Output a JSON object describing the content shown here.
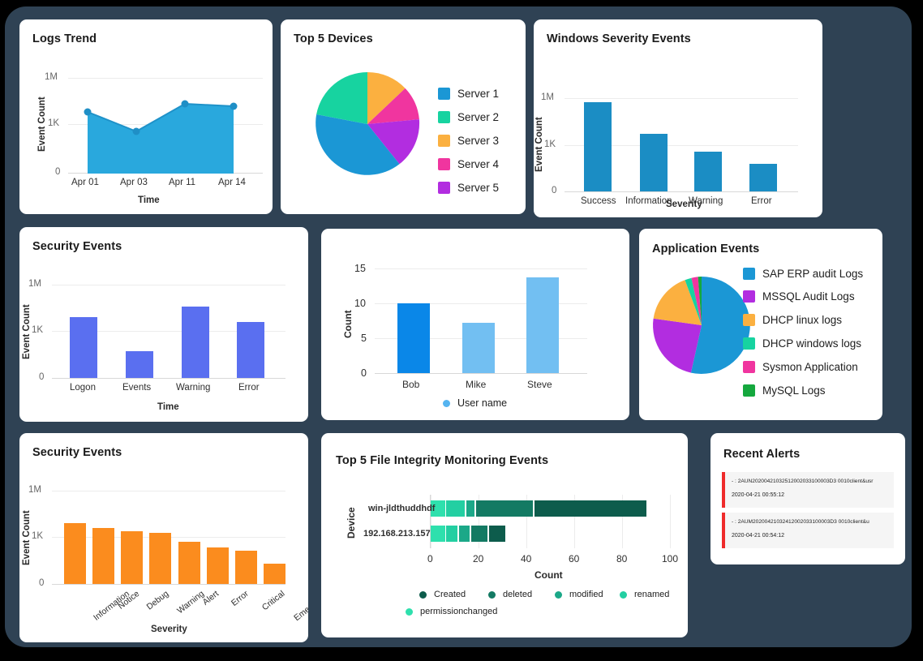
{
  "theme": {
    "panel_bg": "#2f4254",
    "card_bg": "#ffffff",
    "accent_blue": "#1f9fd4",
    "accent_indigo": "#5a6ff0",
    "accent_orange": "#fb8c1e",
    "accent_teal": "#0f7a66",
    "alert_red": "#ef2b2b"
  },
  "cards": {
    "logs_trend": {
      "title": "Logs Trend"
    },
    "top5_devices": {
      "title": "Top 5 Devices"
    },
    "windows_severity": {
      "title": "Windows Severity Events"
    },
    "security_events_time": {
      "title": "Security Events"
    },
    "user_counts": {
      "title": ""
    },
    "application_events": {
      "title": "Application Events"
    },
    "security_events_severity": {
      "title": "Security Events"
    },
    "fim_events": {
      "title": "Top 5 File Integrity Monitoring Events"
    },
    "recent_alerts": {
      "title": "Recent Alerts"
    }
  },
  "chart_data": [
    {
      "id": "logs_trend",
      "type": "area",
      "title": "Logs Trend",
      "xlabel": "Time",
      "ylabel": "Event Count",
      "categories": [
        "Apr 01",
        "Apr 03",
        "Apr 11",
        "Apr 14"
      ],
      "values": [
        1400,
        760,
        1950,
        1850
      ],
      "ytick_labels": [
        "0",
        "1K",
        "1M"
      ],
      "ytick_positions": [
        0,
        1000,
        1000000
      ],
      "ylim": [
        0,
        1000000
      ],
      "grid": true,
      "legend": "none",
      "color": "#29a8dd",
      "marker_color": "#1f8fc6"
    },
    {
      "id": "top5_devices",
      "type": "pie",
      "title": "Top 5 Devices",
      "labels": [
        "Server 1",
        "Server 2",
        "Server 3",
        "Server 4",
        "Server 5"
      ],
      "values": [
        40,
        20,
        13,
        13,
        14
      ],
      "colors": [
        "#1b97d5",
        "#17d3a0",
        "#fbb040",
        "#f0359f",
        "#b22de0"
      ],
      "legend": "right"
    },
    {
      "id": "windows_severity",
      "type": "bar",
      "title": "Windows Severity Events",
      "xlabel": "Severity",
      "ylabel": "Event Count",
      "categories": [
        "Success",
        "Information",
        "Warning",
        "Error"
      ],
      "values": [
        800000,
        1600,
        690,
        430
      ],
      "bar_fractions": [
        0.865,
        0.615,
        0.455,
        0.355
      ],
      "ytick_labels": [
        "0",
        "1K",
        "1M"
      ],
      "ylim": [
        0,
        1000000
      ],
      "grid": true,
      "color": "#1b8dc4"
    },
    {
      "id": "security_events_time",
      "type": "bar",
      "title": "Security Events",
      "xlabel": "Time",
      "ylabel": "Event Count",
      "categories": [
        "Logon",
        "Events",
        "Warning",
        "Error"
      ],
      "values": [
        2400,
        420,
        5800,
        1700
      ],
      "bar_fractions": [
        0.655,
        0.29,
        0.77,
        0.6
      ],
      "ytick_labels": [
        "0",
        "1K",
        "1M"
      ],
      "ylim": [
        0,
        1000000
      ],
      "grid": true,
      "color": "#5a6ff0"
    },
    {
      "id": "user_counts",
      "type": "bar",
      "title": "",
      "xlabel": "",
      "ylabel": "Count",
      "categories": [
        "Bob",
        "Mike",
        "Steve"
      ],
      "values": [
        10,
        7.2,
        13.7
      ],
      "ytick_labels": [
        "0",
        "5",
        "10",
        "15"
      ],
      "ylim": [
        0,
        15
      ],
      "grid": true,
      "legend_label": "User name",
      "legend": "bottom",
      "colors": [
        "#0a87e8",
        "#72bff2",
        "#72bff2"
      ]
    },
    {
      "id": "application_events",
      "type": "pie",
      "title": "Application Events",
      "labels": [
        "SAP ERP audit Logs",
        "MSSQL Audit Logs",
        "DHCP linux logs",
        "DHCP windows logs",
        "Sysmon Application",
        "MySQL Logs"
      ],
      "values": [
        53.5,
        22,
        18,
        2.2,
        2.3,
        2.0
      ],
      "colors": [
        "#1b97d5",
        "#b22de0",
        "#fbb040",
        "#17d3a0",
        "#f0359f",
        "#15a83e"
      ],
      "legend": "right"
    },
    {
      "id": "security_events_severity",
      "type": "bar",
      "title": "Security Events",
      "xlabel": "Severity",
      "ylabel": "Event Count",
      "categories": [
        "Information",
        "Notice",
        "Debug",
        "Warning",
        "Alert",
        "Error",
        "Critical",
        "Emergency"
      ],
      "values": [
        2400,
        1900,
        1500,
        1350,
        930,
        700,
        600,
        250
      ],
      "bar_fractions": [
        0.655,
        0.6,
        0.565,
        0.545,
        0.455,
        0.39,
        0.355,
        0.215
      ],
      "ytick_labels": [
        "0",
        "1K",
        "1M"
      ],
      "ylim": [
        0,
        1000000
      ],
      "grid": true,
      "color": "#fb8c1e"
    },
    {
      "id": "fim_events",
      "type": "bar",
      "orientation": "horizontal",
      "stacked": true,
      "title": "Top 5 File Integrity Monitoring Events",
      "xlabel": "Count",
      "ylabel": "Device",
      "categories": [
        "win-jldthuddhdf",
        "192.168.213.157"
      ],
      "series": [
        {
          "name": "permissionchanged",
          "color": "#2ee0ad",
          "values": [
            6,
            6
          ]
        },
        {
          "name": "renamed",
          "color": "#23cfa2",
          "values": [
            8,
            5
          ]
        },
        {
          "name": "modified",
          "color": "#1ba888",
          "values": [
            4,
            5
          ]
        },
        {
          "name": "deleted",
          "color": "#137a63",
          "values": [
            24,
            7
          ]
        },
        {
          "name": "Created",
          "color": "#0d5c4c",
          "values": [
            47,
            7
          ]
        }
      ],
      "xtick_labels": [
        "0",
        "20",
        "40",
        "60",
        "80",
        "100"
      ],
      "xlim": [
        0,
        100
      ],
      "legend": "bottom",
      "legend_order": [
        "Created",
        "deleted",
        "modified",
        "renamed",
        "permissionchanged"
      ],
      "legend_colors": [
        "#0d5c4c",
        "#137a63",
        "#1ba888",
        "#23cfa2",
        "#2ee0ad"
      ]
    }
  ],
  "recent_alerts": {
    "title": "Recent Alerts",
    "items": [
      {
        "message": "- : 2AUN20200421032512002033100003D3 0010client&usr",
        "timestamp": "2020-04-21 00:55:12"
      },
      {
        "message": " - : 2AUM20200421032412002033100003D3 0010client&u",
        "timestamp": "2020-04-21 00:54:12"
      }
    ]
  }
}
